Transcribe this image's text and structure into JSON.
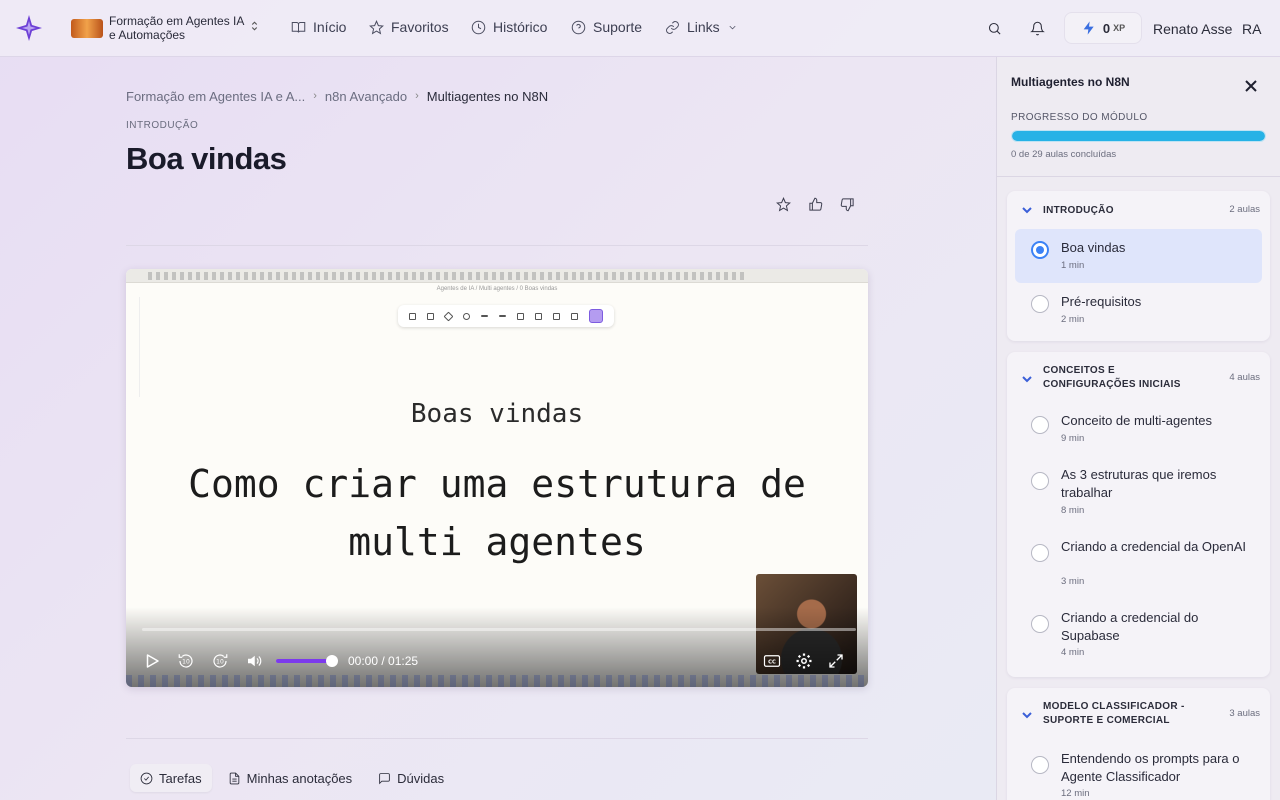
{
  "topnav": {
    "course_name": "Formação em Agentes IA e Automações",
    "items": [
      {
        "label": "Início",
        "icon": "book-icon"
      },
      {
        "label": "Favoritos",
        "icon": "star-icon"
      },
      {
        "label": "Histórico",
        "icon": "clock-icon"
      },
      {
        "label": "Suporte",
        "icon": "help-circle-icon"
      },
      {
        "label": "Links",
        "icon": "link-icon"
      }
    ],
    "xp_value": "0",
    "xp_unit": "XP",
    "user_name": "Renato Asse",
    "user_initials": "RA"
  },
  "breadcrumb": {
    "items": [
      "Formação em Agentes IA e A...",
      "n8n Avançado"
    ],
    "current": "Multiagentes no N8N"
  },
  "lesson": {
    "section": "INTRODUÇÃO",
    "title": "Boa vindas"
  },
  "video": {
    "slide_small": "Boas vindas",
    "slide_big": "Como criar uma estrutura de multi agentes",
    "url_text": "Agentes de IA / Multi agentes / 0 Boas vindas",
    "time": "00:00 / 01:25",
    "volume": 1.0,
    "progress": 0.0
  },
  "tabs": [
    {
      "label": "Tarefas",
      "icon": "check-circle-icon"
    },
    {
      "label": "Minhas anotações",
      "icon": "file-text-icon"
    },
    {
      "label": "Dúvidas",
      "icon": "message-icon"
    }
  ],
  "panel": {
    "title": "Multiagentes no N8N",
    "progress_label": "PROGRESSO DO MÓDULO",
    "progress_fraction": 1.0,
    "progress_count": "0 de 29 aulas concluídas",
    "modules": [
      {
        "title": "INTRODUÇÃO",
        "count": "2 aulas",
        "lessons": [
          {
            "title": "Boa vindas",
            "duration": "1 min",
            "active": true
          },
          {
            "title": "Pré-requisitos",
            "duration": "2 min",
            "active": false
          }
        ]
      },
      {
        "title": "CONCEITOS E CONFIGURAÇÕES INICIAIS",
        "count": "4 aulas",
        "lessons": [
          {
            "title": "Conceito de multi-agentes",
            "duration": "9 min",
            "active": false
          },
          {
            "title": "As 3 estruturas que iremos trabalhar",
            "duration": "8 min",
            "active": false
          },
          {
            "title": "Criando a credencial da OpenAI",
            "duration": "3 min",
            "active": false
          },
          {
            "title": "Criando a credencial do Supabase",
            "duration": "4 min",
            "active": false
          }
        ]
      },
      {
        "title": "MODELO CLASSIFICADOR - SUPORTE E COMERCIAL",
        "count": "3 aulas",
        "lessons": [
          {
            "title": "Entendendo os prompts para o Agente Classificador",
            "duration": "12 min",
            "active": false
          }
        ]
      }
    ]
  },
  "colors": {
    "accent": "#3b82f6",
    "progress": "#26b2e6",
    "volume": "#7c3aed"
  }
}
